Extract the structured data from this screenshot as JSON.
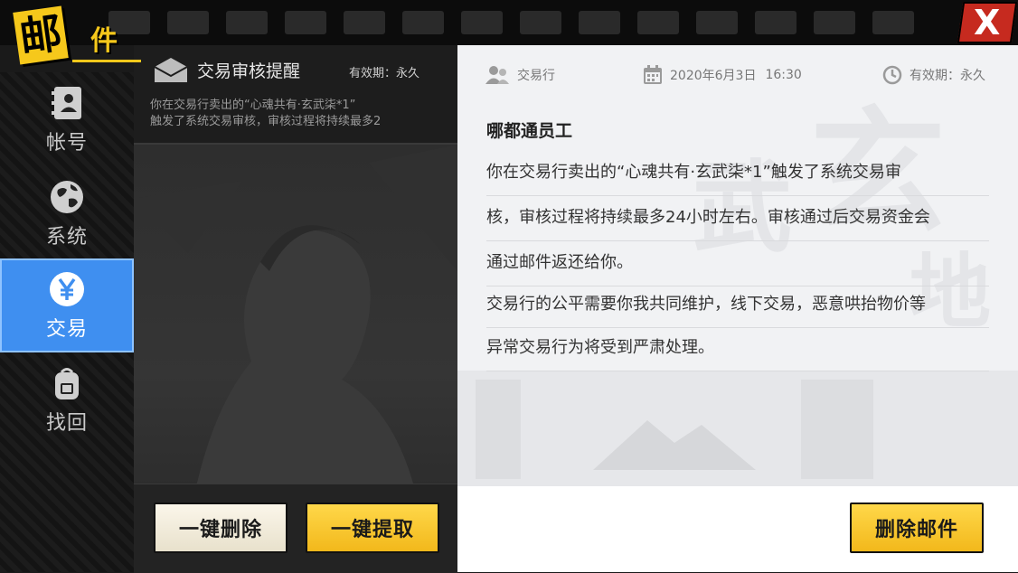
{
  "title": {
    "char1": "邮",
    "char2": "件"
  },
  "close": {
    "label": "X"
  },
  "sidebar": {
    "items": [
      {
        "label": "帐号",
        "icon": "contacts-icon",
        "active": false
      },
      {
        "label": "系统",
        "icon": "globe-icon",
        "active": false
      },
      {
        "label": "交易",
        "icon": "yen-icon",
        "active": true
      },
      {
        "label": "找回",
        "icon": "backpack-icon",
        "active": false
      }
    ]
  },
  "mail_list": {
    "items": [
      {
        "subject": "交易审核提醒",
        "validity": "有效期：永久",
        "preview_line1": "你在交易行卖出的“心魂共有·玄武柒*1”",
        "preview_line2": "触发了系统交易审核，审核过程将持续最多2"
      }
    ],
    "delete_all_label": "一键删除",
    "claim_all_label": "一键提取"
  },
  "mail_detail": {
    "sender_type": "交易行",
    "date": "2020年6月3日",
    "time": "16:30",
    "validity": "有效期：永久",
    "sender": "哪都通员工",
    "body_lines": [
      "你在交易行卖出的“心魂共有·玄武柒*1”触发了系统交易审",
      "核，审核过程将持续最多24小时左右。审核通过后交易资金会",
      "通过邮件返还给你。",
      "交易行的公平需要你我共同维护，线下交易，恶意哄抬物价等",
      "异常交易行为将受到严肃处理。"
    ],
    "delete_label": "删除邮件"
  },
  "colors": {
    "accent_yellow": "#f6c81b",
    "active_tab_blue": "#3f8ff0",
    "close_red": "#c62a1f"
  }
}
